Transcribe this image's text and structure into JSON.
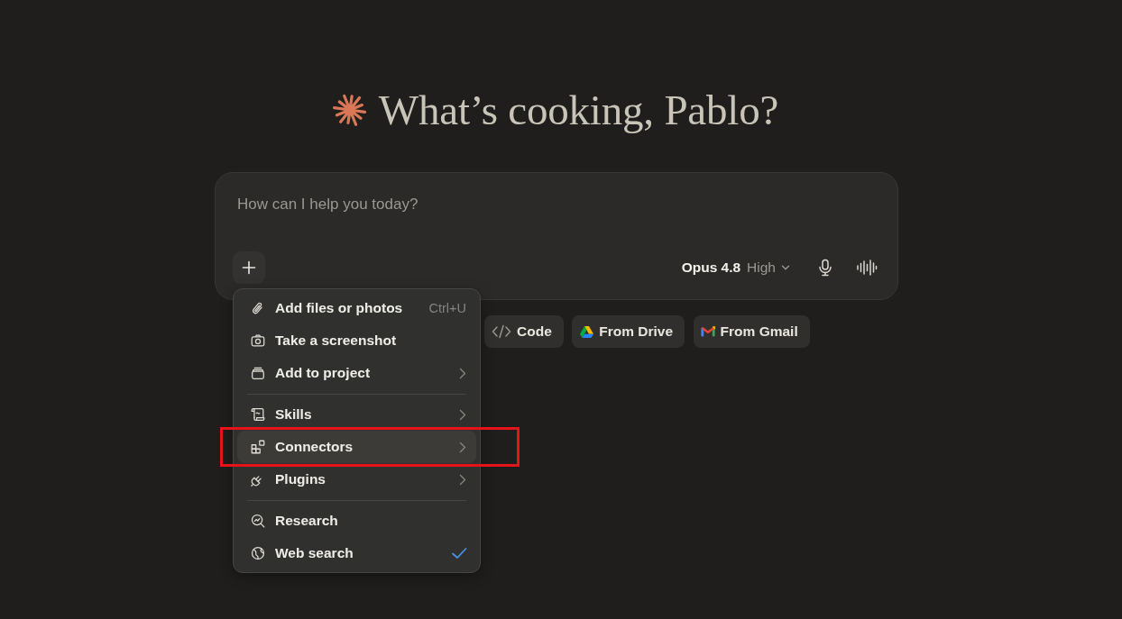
{
  "greeting": {
    "title": "What’s cooking, Pablo?"
  },
  "composer": {
    "placeholder": "How can I help you today?",
    "model": {
      "name": "Opus 4.8",
      "effort": "High"
    }
  },
  "attach_menu": {
    "sections": [
      {
        "items": [
          {
            "label": "Add files or photos",
            "kind": "action",
            "shortcut": "Ctrl+U",
            "hovered": false,
            "checked": false,
            "highlighted": false
          },
          {
            "label": "Take a screenshot",
            "kind": "action",
            "hovered": false,
            "checked": false,
            "highlighted": false
          },
          {
            "label": "Add to project",
            "kind": "submenu",
            "hovered": false,
            "checked": false,
            "highlighted": false
          }
        ]
      },
      {
        "items": [
          {
            "label": "Skills",
            "kind": "submenu",
            "hovered": false,
            "checked": false,
            "highlighted": false
          },
          {
            "label": "Connectors",
            "kind": "submenu",
            "hovered": true,
            "checked": false,
            "highlighted": true
          },
          {
            "label": "Plugins",
            "kind": "submenu",
            "hovered": false,
            "checked": false,
            "highlighted": false
          }
        ]
      },
      {
        "items": [
          {
            "label": "Research",
            "kind": "action",
            "hovered": false,
            "checked": false,
            "highlighted": false
          },
          {
            "label": "Web search",
            "kind": "action",
            "hovered": false,
            "checked": true,
            "highlighted": false
          }
        ]
      }
    ]
  },
  "suggestions": [
    {
      "label": "Code"
    },
    {
      "label": "From Drive"
    },
    {
      "label": "From Gmail"
    }
  ]
}
